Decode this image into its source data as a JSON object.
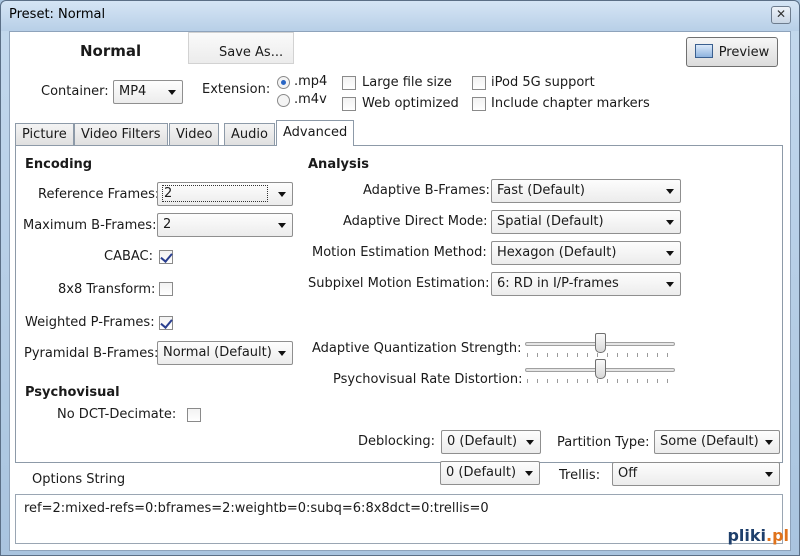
{
  "window": {
    "title": "Preset: Normal",
    "close_symbol": "✕"
  },
  "header": {
    "preset_name": "Normal",
    "save_as_label": "Save As...",
    "preview_label": "Preview",
    "container_label": "Container:",
    "container_value": "MP4",
    "extension_label": "Extension:",
    "ext_mp4": ".mp4",
    "ext_m4v": ".m4v",
    "large_file_label": "Large file size",
    "web_optimized_label": "Web optimized",
    "ipod_label": "iPod 5G support",
    "chapter_markers_label": "Include chapter markers"
  },
  "tabs": [
    "Picture",
    "Video Filters",
    "Video",
    "Audio",
    "Advanced"
  ],
  "encoding": {
    "title": "Encoding",
    "ref_frames_label": "Reference Frames:",
    "ref_frames_value": "2",
    "max_bframes_label": "Maximum B-Frames:",
    "max_bframes_value": "2",
    "cabac_label": "CABAC:",
    "transform_label": "8x8 Transform:",
    "weighted_label": "Weighted P-Frames:",
    "pyramidal_label": "Pyramidal B-Frames:",
    "pyramidal_value": "Normal (Default)"
  },
  "psychovisual": {
    "title": "Psychovisual",
    "no_dct_label": "No DCT-Decimate:"
  },
  "analysis": {
    "title": "Analysis",
    "adaptive_b_label": "Adaptive B-Frames:",
    "adaptive_b_value": "Fast (Default)",
    "direct_mode_label": "Adaptive Direct Mode:",
    "direct_mode_value": "Spatial (Default)",
    "motion_label": "Motion Estimation Method:",
    "motion_value": "Hexagon (Default)",
    "subpixel_label": "Subpixel Motion Estimation:",
    "subpixel_value": "6: RD in I/P-frames",
    "aq_label": "Adaptive Quantization Strength:",
    "aq_level": 0.5,
    "psy_rd_label": "Psychovisual Rate Distortion:",
    "psy_rd_level": 0.5
  },
  "lower": {
    "deblocking_label": "Deblocking:",
    "deblocking_value_1": "0 (Default)",
    "deblocking_value_2": "0 (Default)",
    "partition_label": "Partition Type:",
    "partition_value": "Some (Default)",
    "trellis_label": "Trellis:",
    "trellis_value": "Off"
  },
  "options_string": {
    "label": "Options String",
    "value": "ref=2:mixed-refs=0:bframes=2:weightb=0:subq=6:8x8dct=0:trellis=0"
  },
  "watermark": {
    "text_main": "pliki",
    "text_dot": ".pl"
  }
}
